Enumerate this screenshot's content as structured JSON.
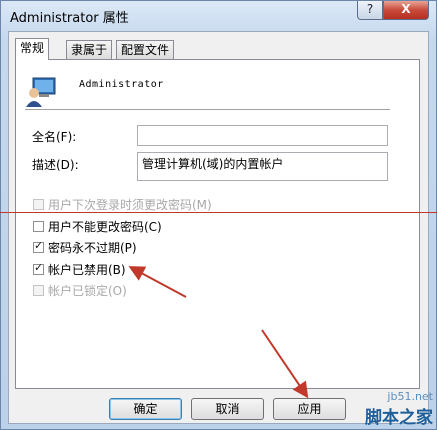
{
  "window": {
    "title": "Administrator 属性",
    "help_label": "?",
    "close_label": "X"
  },
  "tabs": [
    {
      "label": "常规",
      "active": true
    },
    {
      "label": "隶属于",
      "active": false
    },
    {
      "label": "配置文件",
      "active": false
    }
  ],
  "user": {
    "name": "Administrator",
    "icon": "user-computer-icon"
  },
  "fields": {
    "full_name_label": "全名(F):",
    "full_name_value": "",
    "description_label": "描述(D):",
    "description_value": "管理计算机(域)的内置帐户"
  },
  "checkboxes": [
    {
      "label": "用户下次登录时须更改密码(M)",
      "checked": false,
      "disabled": true
    },
    {
      "label": "用户不能更改密码(C)",
      "checked": false,
      "disabled": false
    },
    {
      "label": "密码永不过期(P)",
      "checked": true,
      "disabled": false
    },
    {
      "label": "帐户已禁用(B)",
      "checked": true,
      "disabled": false
    },
    {
      "label": "帐户已锁定(O)",
      "checked": false,
      "disabled": true
    }
  ],
  "buttons": {
    "ok": "确定",
    "cancel": "取消",
    "apply": "应用"
  },
  "watermark": {
    "url": "jb51.net",
    "name": "脚本之家"
  },
  "colors": {
    "annotation": "#c0392b",
    "close": "#c94a3a"
  }
}
